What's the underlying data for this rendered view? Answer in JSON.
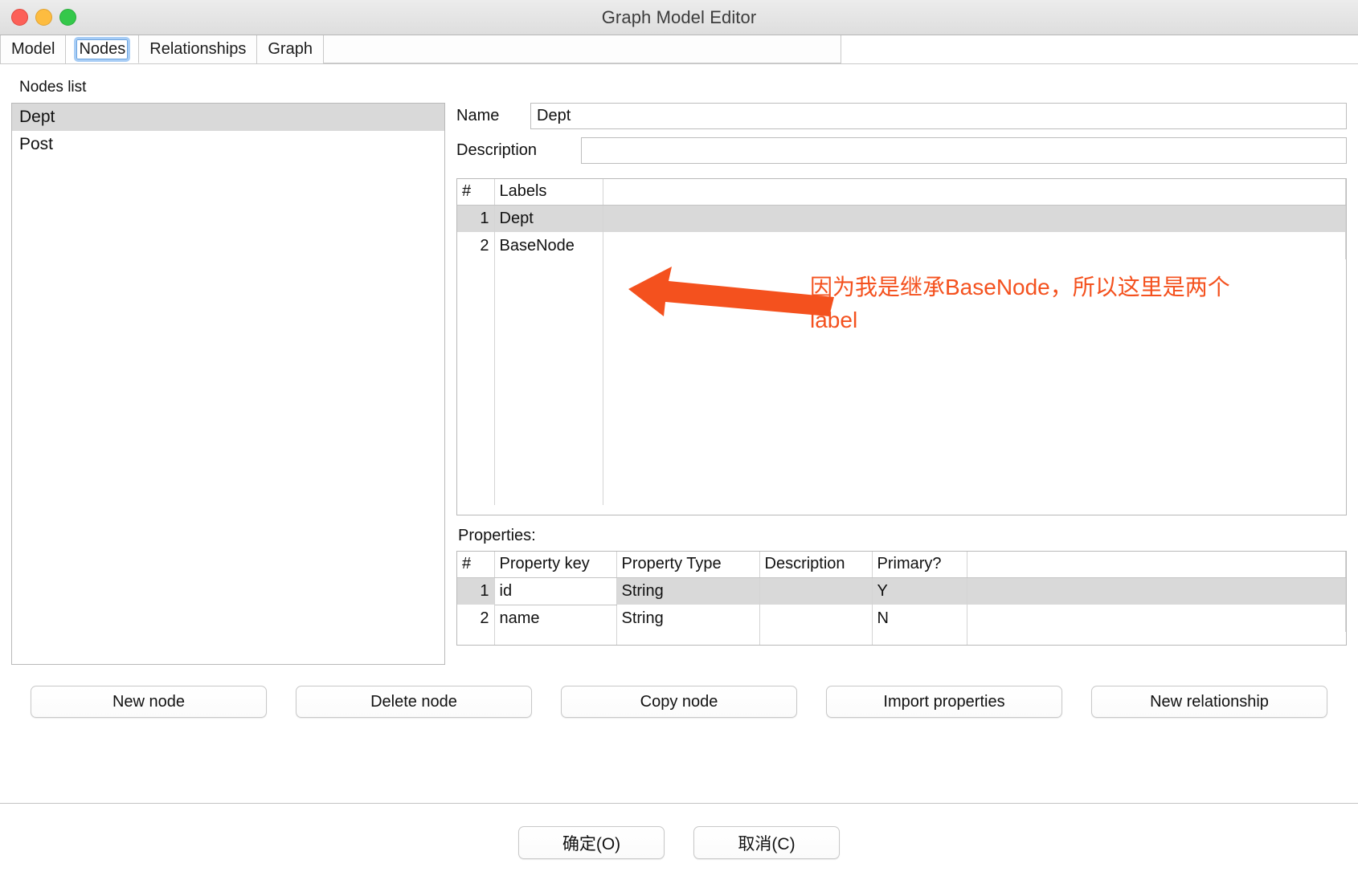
{
  "window": {
    "title": "Graph Model Editor",
    "controls": [
      "close-button",
      "minimize-button",
      "zoom-button"
    ]
  },
  "tabs": [
    {
      "label": "Model",
      "selected": false
    },
    {
      "label": "Nodes",
      "selected": true
    },
    {
      "label": "Relationships",
      "selected": false
    },
    {
      "label": "Graph",
      "selected": false
    }
  ],
  "nodes_list": {
    "heading": "Nodes list",
    "items": [
      {
        "label": "Dept",
        "selected": true
      },
      {
        "label": "Post",
        "selected": false
      }
    ]
  },
  "detail": {
    "name_label": "Name",
    "name_value": "Dept",
    "description_label": "Description",
    "description_value": "",
    "description_placeholder": ""
  },
  "labels_table": {
    "columns": [
      "#",
      "Labels",
      ""
    ],
    "rows": [
      {
        "num": "1",
        "label": "Dept",
        "selected": true
      },
      {
        "num": "2",
        "label": "BaseNode",
        "selected": false
      }
    ],
    "empty_row_count": 9
  },
  "properties": {
    "title": "Properties:",
    "columns": [
      "#",
      "Property key",
      "Property Type",
      "Description",
      "Primary?",
      ""
    ],
    "rows": [
      {
        "num": "1",
        "key": "id",
        "type": "String",
        "description": "",
        "primary": "Y",
        "selected": true,
        "editing_cell": "key"
      },
      {
        "num": "2",
        "key": "name",
        "type": "String",
        "description": "",
        "primary": "N",
        "selected": false,
        "editing_cell": ""
      }
    ]
  },
  "actions": [
    {
      "label": "New node"
    },
    {
      "label": "Delete node"
    },
    {
      "label": "Copy node"
    },
    {
      "label": "Import properties"
    },
    {
      "label": "New relationship"
    }
  ],
  "footer": {
    "ok_label": "确定(O)",
    "cancel_label": "取消(C)"
  },
  "annotation": {
    "text": "因为我是继承BaseNode，所以这里是两个label",
    "color": "#f4511e",
    "arrow": "left-arrow-icon"
  },
  "colors": {
    "annotation": "#f4511e",
    "selection": "#d9d9d9",
    "tab_focus_ring": "#a8cdf5",
    "traffic_red": "#fc6058",
    "traffic_yellow": "#fdbc40",
    "traffic_green": "#34c84a"
  }
}
